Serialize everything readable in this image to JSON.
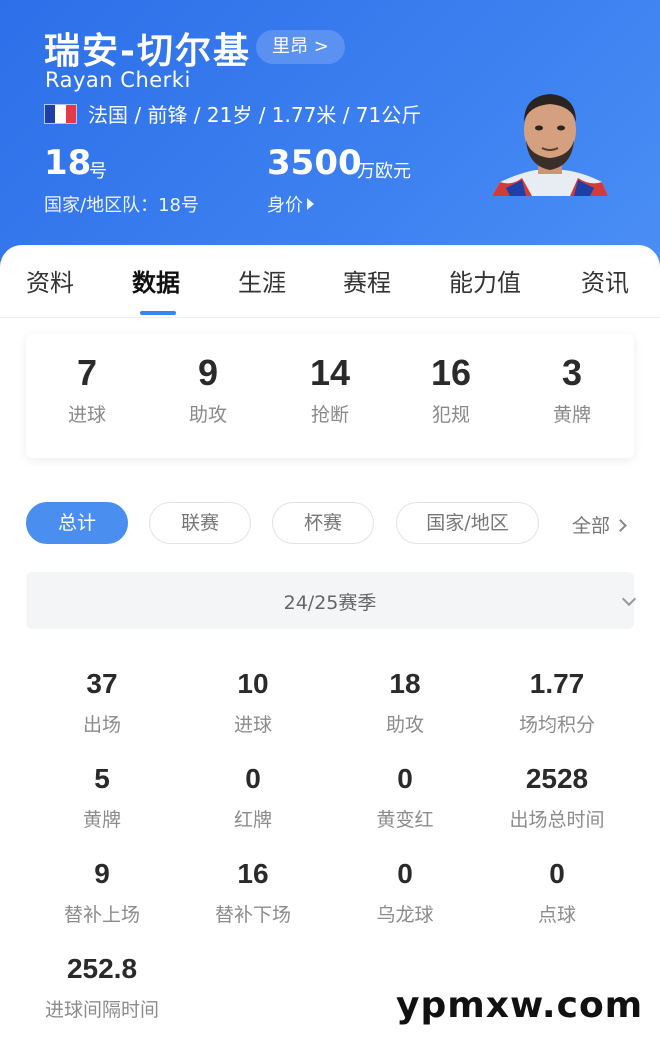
{
  "player": {
    "name_cn": "瑞安-切尔基",
    "club": "里昂 >",
    "name_en": "Rayan Cherki",
    "info": "法国 / 前锋 / 21岁 / 1.77米 / 71公斤",
    "flag_colors": [
      "#1f3fa8",
      "#ffffff",
      "#e63946"
    ],
    "number": "18",
    "number_unit": "号",
    "national_number": "国家/地区队：18号",
    "value": "3500",
    "value_unit": "万欧元",
    "value_label": "身价"
  },
  "tabs": [
    {
      "label": "资料"
    },
    {
      "label": "数据"
    },
    {
      "label": "生涯"
    },
    {
      "label": "赛程"
    },
    {
      "label": "能力值"
    },
    {
      "label": "资讯"
    }
  ],
  "active_tab": "数据",
  "summary": [
    {
      "value": "7",
      "label": "进球"
    },
    {
      "value": "9",
      "label": "助攻"
    },
    {
      "value": "14",
      "label": "抢断"
    },
    {
      "value": "16",
      "label": "犯规"
    },
    {
      "value": "3",
      "label": "黄牌"
    }
  ],
  "filters": [
    {
      "label": "总计"
    },
    {
      "label": "联赛"
    },
    {
      "label": "杯赛"
    },
    {
      "label": "国家/地区"
    }
  ],
  "filter_all": "全部",
  "season": "24/25赛季",
  "stats": [
    {
      "value": "37",
      "label": "出场"
    },
    {
      "value": "10",
      "label": "进球"
    },
    {
      "value": "18",
      "label": "助攻"
    },
    {
      "value": "1.77",
      "label": "场均积分"
    },
    {
      "value": "5",
      "label": "黄牌"
    },
    {
      "value": "0",
      "label": "红牌"
    },
    {
      "value": "0",
      "label": "黄变红"
    },
    {
      "value": "2528",
      "label": "出场总时间"
    },
    {
      "value": "9",
      "label": "替补上场"
    },
    {
      "value": "16",
      "label": "替补下场"
    },
    {
      "value": "0",
      "label": "乌龙球"
    },
    {
      "value": "0",
      "label": "点球"
    },
    {
      "value": "252.8",
      "label": "进球间隔时间"
    }
  ],
  "watermark": "ypmxw.com",
  "colors": {
    "header": "#3b7ff0",
    "accent": "#4a8ff0"
  }
}
